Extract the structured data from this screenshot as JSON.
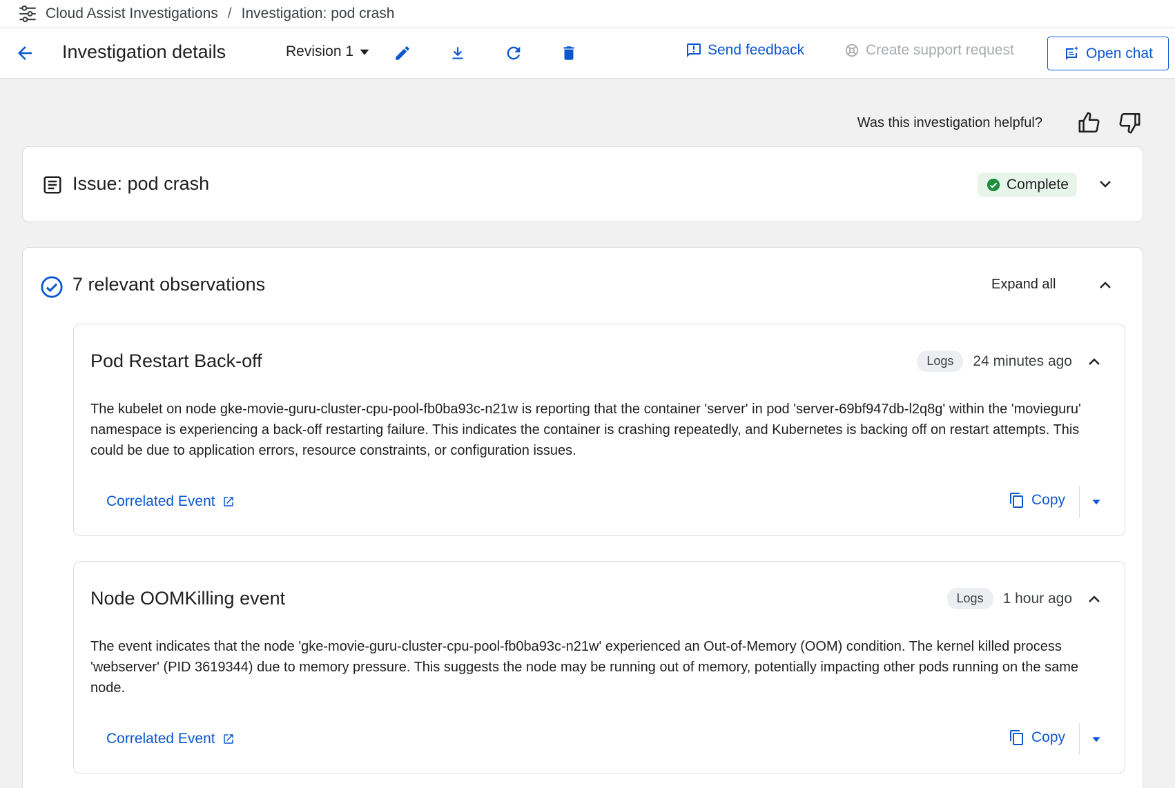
{
  "breadcrumb": {
    "root": "Cloud Assist Investigations",
    "separator": "/",
    "current": "Investigation: pod crash"
  },
  "toolbar": {
    "title": "Investigation details",
    "revision": "Revision 1",
    "send_feedback": "Send feedback",
    "create_support_request": "Create support request",
    "open_chat": "Open chat"
  },
  "feedback": {
    "question": "Was this investigation helpful?"
  },
  "issue": {
    "title": "Issue: pod crash",
    "status": "Complete"
  },
  "observations": {
    "title": "7 relevant observations",
    "expand_all": "Expand all",
    "items": [
      {
        "title": "Pod Restart Back-off",
        "source": "Logs",
        "time": "24 minutes ago",
        "description": "The kubelet on node gke-movie-guru-cluster-cpu-pool-fb0ba93c-n21w is reporting that the container 'server' in pod 'server-69bf947db-l2q8g' within the 'movieguru' namespace is experiencing a back-off restarting failure. This indicates the container is crashing repeatedly, and Kubernetes is backing off on restart attempts. This could be due to application errors, resource constraints, or configuration issues.",
        "correlated_label": "Correlated Event",
        "copy_label": "Copy"
      },
      {
        "title": "Node OOMKilling event",
        "source": "Logs",
        "time": "1 hour ago",
        "description": "The event indicates that the node 'gke-movie-guru-cluster-cpu-pool-fb0ba93c-n21w' experienced an Out-of-Memory (OOM) condition. The kernel killed process 'webserver' (PID 3619344) due to memory pressure. This suggests the node may be running out of memory, potentially impacting other pods running on the same node.",
        "correlated_label": "Correlated Event",
        "copy_label": "Copy"
      }
    ]
  },
  "colors": {
    "accent": "#0b57d0",
    "success": "#1e8e3e",
    "success_bg": "#e6f4ea",
    "disabled": "#a8abaf"
  }
}
